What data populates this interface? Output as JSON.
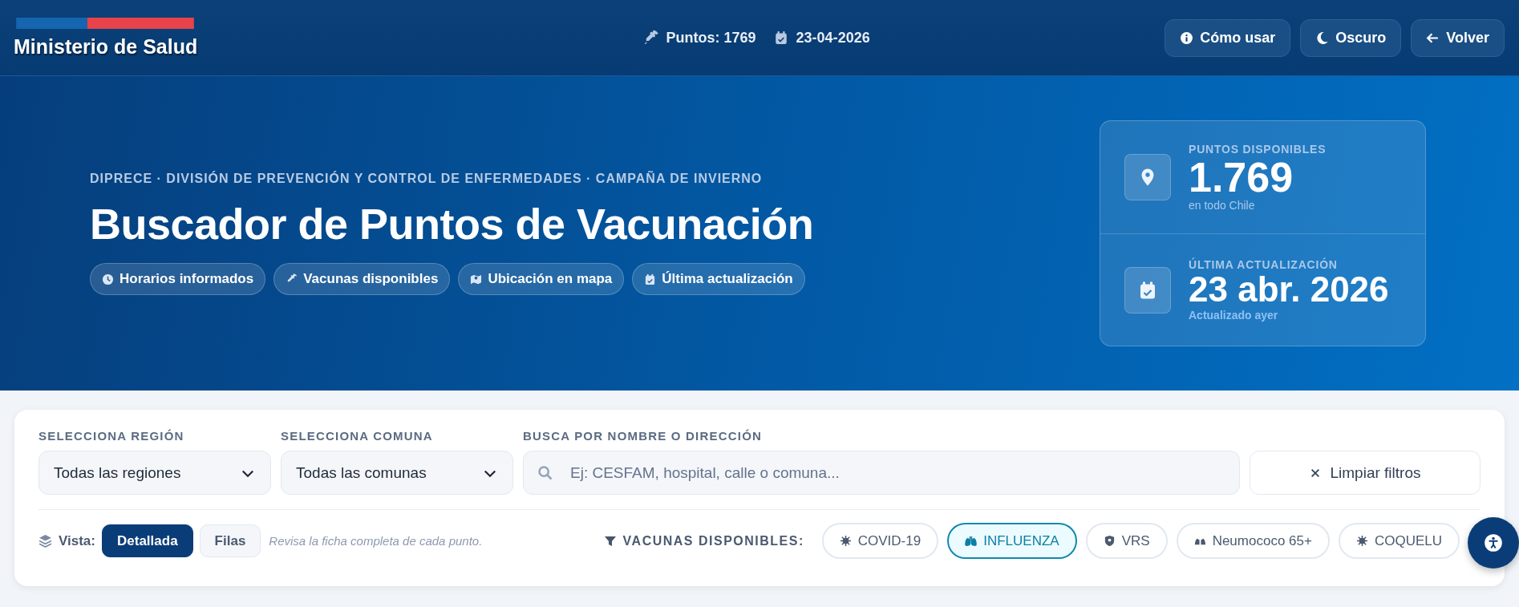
{
  "header": {
    "logo": "Ministerio de Salud",
    "points_label": "Puntos:",
    "points_value": "1769",
    "date": "23-04-2026",
    "buttons": [
      "Cómo usar",
      "Oscuro",
      "Volver"
    ]
  },
  "hero": {
    "eyebrow": "DIPRECE · DIVISIÓN DE PREVENCIÓN Y CONTROL DE ENFERMEDADES · CAMPAÑA DE INVIERNO",
    "title": "Buscador de Puntos de Vacunación",
    "chips": [
      "Horarios informados",
      "Vacunas disponibles",
      "Ubicación en mapa",
      "Última actualización"
    ],
    "stats": [
      {
        "label": "PUNTOS DISPONIBLES",
        "value": "1.769",
        "note": "en todo Chile"
      },
      {
        "label": "ÚLTIMA ACTUALIZACIÓN",
        "value": "23 abr. 2026",
        "note": "Actualizado ayer"
      }
    ]
  },
  "filters": {
    "region": {
      "label": "SELECCIONA REGIÓN",
      "value": "Todas las regiones"
    },
    "comuna": {
      "label": "SELECCIONA COMUNA",
      "value": "Todas las comunas"
    },
    "search": {
      "label": "BUSCA POR NOMBRE O DIRECCIÓN",
      "placeholder": "Ej: CESFAM, hospital, calle o comuna..."
    },
    "clear_button": "Limpiar filtros"
  },
  "view": {
    "label": "Vista:",
    "options": [
      {
        "label": "Detallada",
        "selected": true
      },
      {
        "label": "Filas",
        "selected": false
      }
    ],
    "hint": "Revisa la ficha completa de cada punto."
  },
  "vaccines": {
    "label": "VACUNAS DISPONIBLES:",
    "items": [
      {
        "label": "COVID-19",
        "selected": false
      },
      {
        "label": "INFLUENZA",
        "selected": true
      },
      {
        "label": "VRS",
        "selected": false
      },
      {
        "label": "Neumococo 65+",
        "selected": false
      },
      {
        "label": "COQUELU",
        "selected": false
      }
    ]
  }
}
